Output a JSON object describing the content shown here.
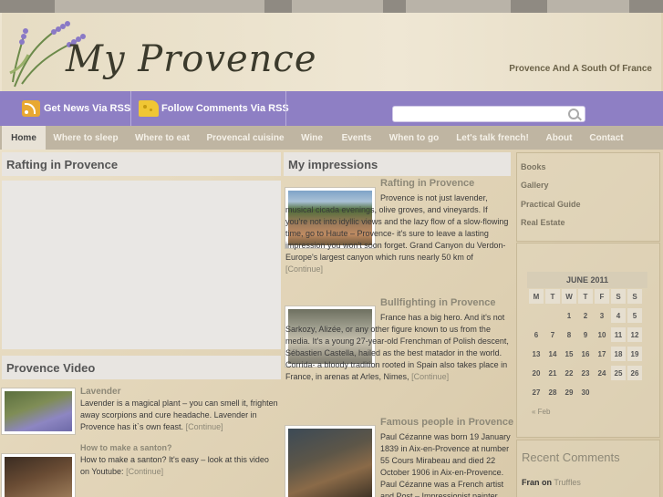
{
  "site": {
    "title": "My Provence",
    "tagline": "Provence And A South Of France"
  },
  "subbar": {
    "news_label": "Get News Via RSS",
    "comments_label": "Follow Comments Via RSS",
    "search_placeholder": ""
  },
  "nav": [
    "Home",
    "Where to sleep",
    "Where to eat",
    "Provencal cuisine",
    "Wine",
    "Events",
    "When to go",
    "Let's talk french!",
    "About",
    "Contact"
  ],
  "left": {
    "top_heading": "Rafting in Provence",
    "video_heading": "Provence Video",
    "videos": [
      {
        "title": "Lavender",
        "text": "Lavender is a magical plant – you can smell it, frighten away scorpions and cure headache. Lavender in Provence has it`s own feast.",
        "more": "[Continue]"
      },
      {
        "title": "How to make a santon?",
        "text": "How to make a santon? It's easy – look at this video on Youtube:",
        "more": "[Continue]"
      }
    ]
  },
  "middle": {
    "heading": "My impressions",
    "posts": [
      {
        "title": "Rafting in Provence",
        "text": "Provence is not just lavender, musical cicada evenings, olive groves, and vineyards. If you're not into idyllic views and the lazy flow of a slow-flowing time, go to Haute – Provence- it's sure to leave a lasting impression you won't soon forget. Grand Canyon du Verdon- Europe's largest canyon which runs nearly 50 km of",
        "more": "[Continue]"
      },
      {
        "title": "Bullfighting in Provence",
        "text": "France has a big hero. And it's not Sarkozy, Alizée, or any other figure known to us from the media. It's a young 27-year-old Frenchman of Polish descent, Sébastien Castella, hailed as the best matador in the world. Corrida- a bloody tradition rooted in Spain also takes place in France, in arenas at Arles, Nimes,",
        "more": "[Continue]"
      },
      {
        "title": "Famous people in Provence",
        "text": "Paul Cézanne was born 19 January 1839 in Aix-en-Provence at number 55 Cours Mirabeau and died 22 October 1906 in Aix-en-Provence. Paul Cézanne was a French artist and Post – Impressionist painter",
        "more": ""
      }
    ]
  },
  "sidebar": {
    "links": [
      "Books",
      "Gallery",
      "Practical Guide",
      "Real Estate"
    ],
    "calendar": {
      "title": "JUNE 2011",
      "days": [
        "M",
        "T",
        "W",
        "T",
        "F",
        "S",
        "S"
      ],
      "weeks": [
        [
          "",
          "",
          "1",
          "2",
          "3",
          "4",
          "5"
        ],
        [
          "6",
          "7",
          "8",
          "9",
          "10",
          "11",
          "12"
        ],
        [
          "13",
          "14",
          "15",
          "16",
          "17",
          "18",
          "19"
        ],
        [
          "20",
          "21",
          "22",
          "23",
          "24",
          "25",
          "26"
        ],
        [
          "27",
          "28",
          "29",
          "30",
          "",
          "",
          ""
        ]
      ],
      "prev": "« Feb"
    },
    "recent_comments_title": "Recent Comments",
    "recent_comment": {
      "author": "Fran",
      "on": "on",
      "post": "Truffles"
    }
  }
}
